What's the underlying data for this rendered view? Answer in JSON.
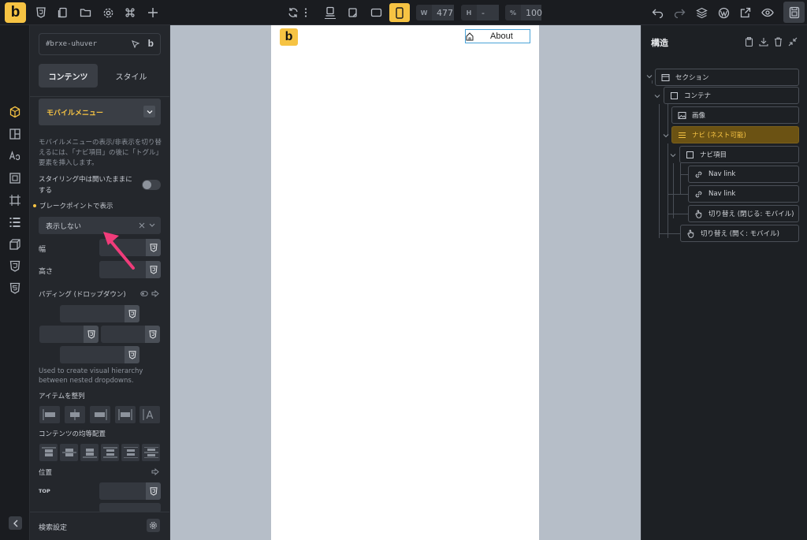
{
  "topbar": {
    "logo": "b",
    "width_label": "W",
    "width_value": "477",
    "height_label": "H",
    "height_value": "-",
    "zoom_label": "%",
    "zoom_value": "100"
  },
  "panel": {
    "element_id": "#brxe-uhuver",
    "tabs": [
      "コンテンツ",
      "スタイル"
    ],
    "active_tab": "コンテンツ",
    "section_title": "モバイルメニュー",
    "description": "モバイルメニューの表示/非表示を切り替えるには、「ナビ項目」の後に「トグル」要素を挿入します。",
    "keep_open_label": "スタイリング中は開いたままにする",
    "breakpoint_label": "ブレークポイントで表示",
    "breakpoint_value": "表示しない",
    "width_label": "幅",
    "height_label": "高さ",
    "padding_label": "パディング (ドロップダウン)",
    "help_text": "Used to create visual hierarchy between nested dropdowns.",
    "align_items_label": "アイテムを整列",
    "justify_label": "コンテンツの均等配置",
    "position_label": "位置",
    "top_label": "TOP",
    "footer_label": "検索設定"
  },
  "canvas": {
    "logo": "b",
    "nav_item": "About"
  },
  "structure": {
    "title": "構造",
    "nodes": [
      {
        "label": "セクション"
      },
      {
        "label": "コンテナ"
      },
      {
        "label": "画像"
      },
      {
        "label": "ナビ (ネスト可能)"
      },
      {
        "label": "ナビ項目"
      },
      {
        "label": "Nav link"
      },
      {
        "label": "Nav link"
      },
      {
        "label": "切り替え (閉じる: モバイル)"
      },
      {
        "label": "切り替え (開く: モバイル)"
      }
    ]
  },
  "colors": {
    "accent": "#f6c343",
    "arrow": "#f03c7a",
    "active_node_bg": "#6b5213"
  }
}
